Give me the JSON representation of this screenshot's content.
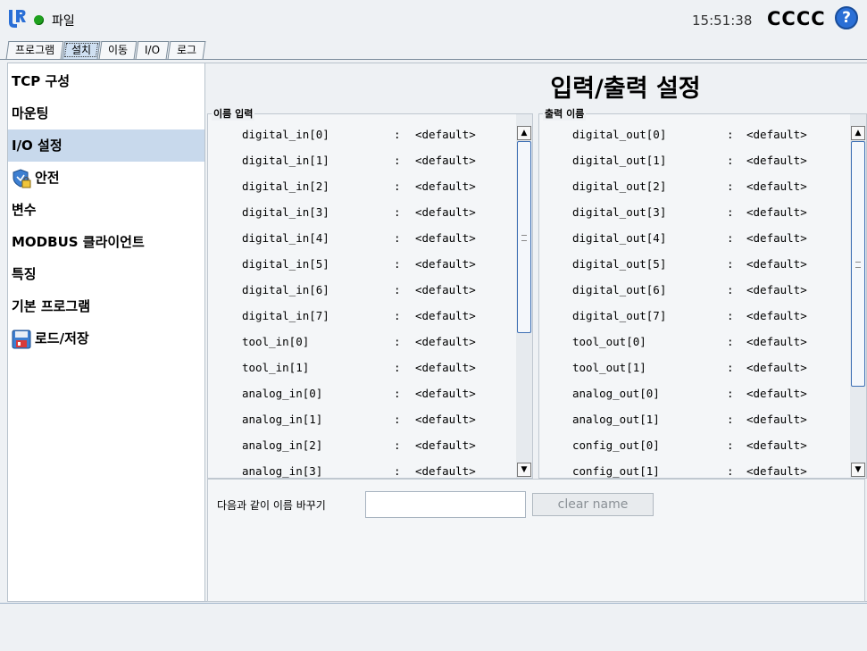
{
  "header": {
    "menu_label": "파일",
    "clock": "15:51:38",
    "robot_name": "CCCC",
    "help_label": "?"
  },
  "tabs": [
    {
      "label": "프로그램",
      "active": false
    },
    {
      "label": "설치",
      "active": true
    },
    {
      "label": "이동",
      "active": false
    },
    {
      "label": "I/O",
      "active": false
    },
    {
      "label": "로그",
      "active": false
    }
  ],
  "sidebar": {
    "items": [
      {
        "label": "TCP 구성",
        "icon": "",
        "selected": false
      },
      {
        "label": "마운팅",
        "icon": "",
        "selected": false
      },
      {
        "label": "I/O 설정",
        "icon": "",
        "selected": true
      },
      {
        "label": "안전",
        "icon": "shield-lock-icon",
        "selected": false
      },
      {
        "label": "변수",
        "icon": "",
        "selected": false
      },
      {
        "label": "MODBUS 클라이언트",
        "icon": "",
        "selected": false
      },
      {
        "label": "특징",
        "icon": "",
        "selected": false
      },
      {
        "label": "기본 프로그램",
        "icon": "",
        "selected": false
      },
      {
        "label": "로드/저장",
        "icon": "floppy-icon",
        "selected": false
      }
    ]
  },
  "main": {
    "title": "입력/출력 설정",
    "inputs": {
      "label": "이름 입력",
      "separator": ":",
      "rows": [
        {
          "name": "digital_in[0]",
          "value": "<default>"
        },
        {
          "name": "digital_in[1]",
          "value": "<default>"
        },
        {
          "name": "digital_in[2]",
          "value": "<default>"
        },
        {
          "name": "digital_in[3]",
          "value": "<default>"
        },
        {
          "name": "digital_in[4]",
          "value": "<default>"
        },
        {
          "name": "digital_in[5]",
          "value": "<default>"
        },
        {
          "name": "digital_in[6]",
          "value": "<default>"
        },
        {
          "name": "digital_in[7]",
          "value": "<default>"
        },
        {
          "name": "tool_in[0]",
          "value": "<default>"
        },
        {
          "name": "tool_in[1]",
          "value": "<default>"
        },
        {
          "name": "analog_in[0]",
          "value": "<default>"
        },
        {
          "name": "analog_in[1]",
          "value": "<default>"
        },
        {
          "name": "analog_in[2]",
          "value": "<default>"
        },
        {
          "name": "analog_in[3]",
          "value": "<default>"
        }
      ]
    },
    "outputs": {
      "label": "출력 이름",
      "separator": ":",
      "rows": [
        {
          "name": "digital_out[0]",
          "value": "<default>"
        },
        {
          "name": "digital_out[1]",
          "value": "<default>"
        },
        {
          "name": "digital_out[2]",
          "value": "<default>"
        },
        {
          "name": "digital_out[3]",
          "value": "<default>"
        },
        {
          "name": "digital_out[4]",
          "value": "<default>"
        },
        {
          "name": "digital_out[5]",
          "value": "<default>"
        },
        {
          "name": "digital_out[6]",
          "value": "<default>"
        },
        {
          "name": "digital_out[7]",
          "value": "<default>"
        },
        {
          "name": "tool_out[0]",
          "value": "<default>"
        },
        {
          "name": "tool_out[1]",
          "value": "<default>"
        },
        {
          "name": "analog_out[0]",
          "value": "<default>"
        },
        {
          "name": "analog_out[1]",
          "value": "<default>"
        },
        {
          "name": "config_out[0]",
          "value": "<default>"
        },
        {
          "name": "config_out[1]",
          "value": "<default>"
        }
      ]
    },
    "rename": {
      "label": "다음과 같이 이름 바꾸기",
      "value": "",
      "clear_label": "clear name"
    }
  },
  "colors": {
    "accent": "#2a6fd6",
    "status_ok": "#1ea01e",
    "selected_bg": "#c8d9ec"
  }
}
